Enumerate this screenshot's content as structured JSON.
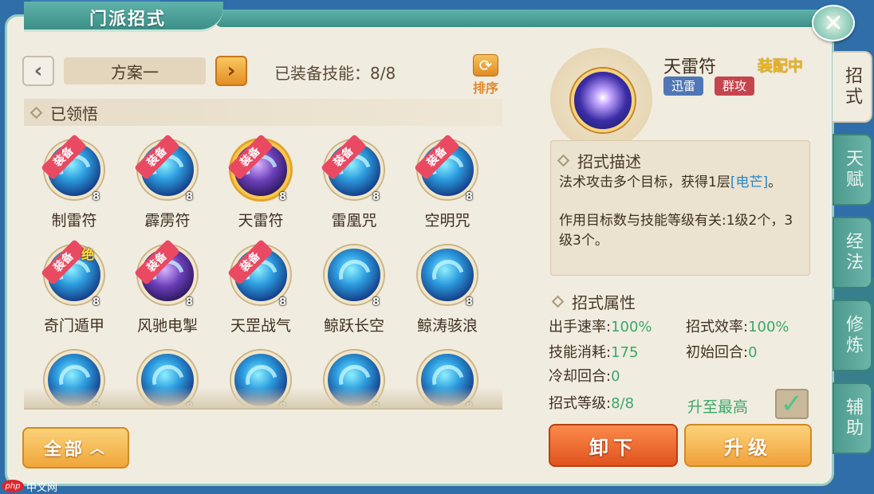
{
  "window": {
    "title": "门派招式",
    "close_icon": "close-icon"
  },
  "scheme": {
    "prev_icon": "chevron-left-icon",
    "name": "方案一",
    "next_icon": "chevron-right-icon"
  },
  "equipped": {
    "label": "已装备技能：8/8"
  },
  "sort": {
    "label": "排序",
    "icon": "refresh-icon"
  },
  "learned_section": {
    "title": "已领悟"
  },
  "skills": [
    {
      "name": "制雷符",
      "level": "8",
      "badge": "装备"
    },
    {
      "name": "霹雳符",
      "level": "8",
      "badge": "装备"
    },
    {
      "name": "天雷符",
      "level": "8",
      "badge": "装备",
      "selected": true
    },
    {
      "name": "雷凰咒",
      "level": "8",
      "badge": "装备"
    },
    {
      "name": "空明咒",
      "level": "8",
      "badge": "装备"
    },
    {
      "name": "奇门遁甲",
      "level": "8",
      "badge": "装备",
      "mark": "绝"
    },
    {
      "name": "风驰电掣",
      "level": "8",
      "badge": "装备"
    },
    {
      "name": "天罡战气",
      "level": "8",
      "badge": "装备"
    },
    {
      "name": "鲸跃长空",
      "level": "8"
    },
    {
      "name": "鲸涛骇浪",
      "level": "8"
    },
    {
      "name": "",
      "level": "8"
    },
    {
      "name": "",
      "level": "8"
    },
    {
      "name": "",
      "level": "8"
    },
    {
      "name": "",
      "level": "8"
    },
    {
      "name": "",
      "level": "8"
    }
  ],
  "filter": {
    "label": "全部",
    "icon": "chevron-up-icon"
  },
  "detail": {
    "name": "天雷符",
    "status": "装配中",
    "tags": [
      "迅雷",
      "群攻"
    ],
    "desc_title": "招式描述",
    "desc_prefix": "法术攻击多个目标，获得1层",
    "desc_highlight": "[电芒]",
    "desc_suffix": "。",
    "desc_extra": "作用目标数与技能等级有关:1级2个，3级3个。",
    "attr_title": "招式属性",
    "attrs": {
      "speed_label": "出手速率:",
      "speed_value": "100%",
      "efficiency_label": "招式效率:",
      "efficiency_value": "100%",
      "cost_label": "技能消耗:",
      "cost_value": "175",
      "start_label": "初始回合:",
      "start_value": "0",
      "cooldown_label": "冷却回合:",
      "cooldown_value": "0",
      "level_label": "招式等级:",
      "level_value": "8/8"
    },
    "auto_max_label": "升至最高",
    "auto_max_checked": true
  },
  "actions": {
    "unload": "卸下",
    "upgrade": "升级"
  },
  "side_tabs": [
    {
      "label": "招式",
      "active": true
    },
    {
      "label": "天赋",
      "active": false
    },
    {
      "label": "经法",
      "active": false
    },
    {
      "label": "修炼",
      "active": false
    },
    {
      "label": "辅助",
      "active": false
    }
  ],
  "watermark": {
    "logo": "php",
    "text": "中文网"
  },
  "colors": {
    "accent_teal": "#3d8f88",
    "orange": "#f0a13a",
    "highlight_green": "#3aa86a",
    "link_blue": "#2a86c8"
  }
}
